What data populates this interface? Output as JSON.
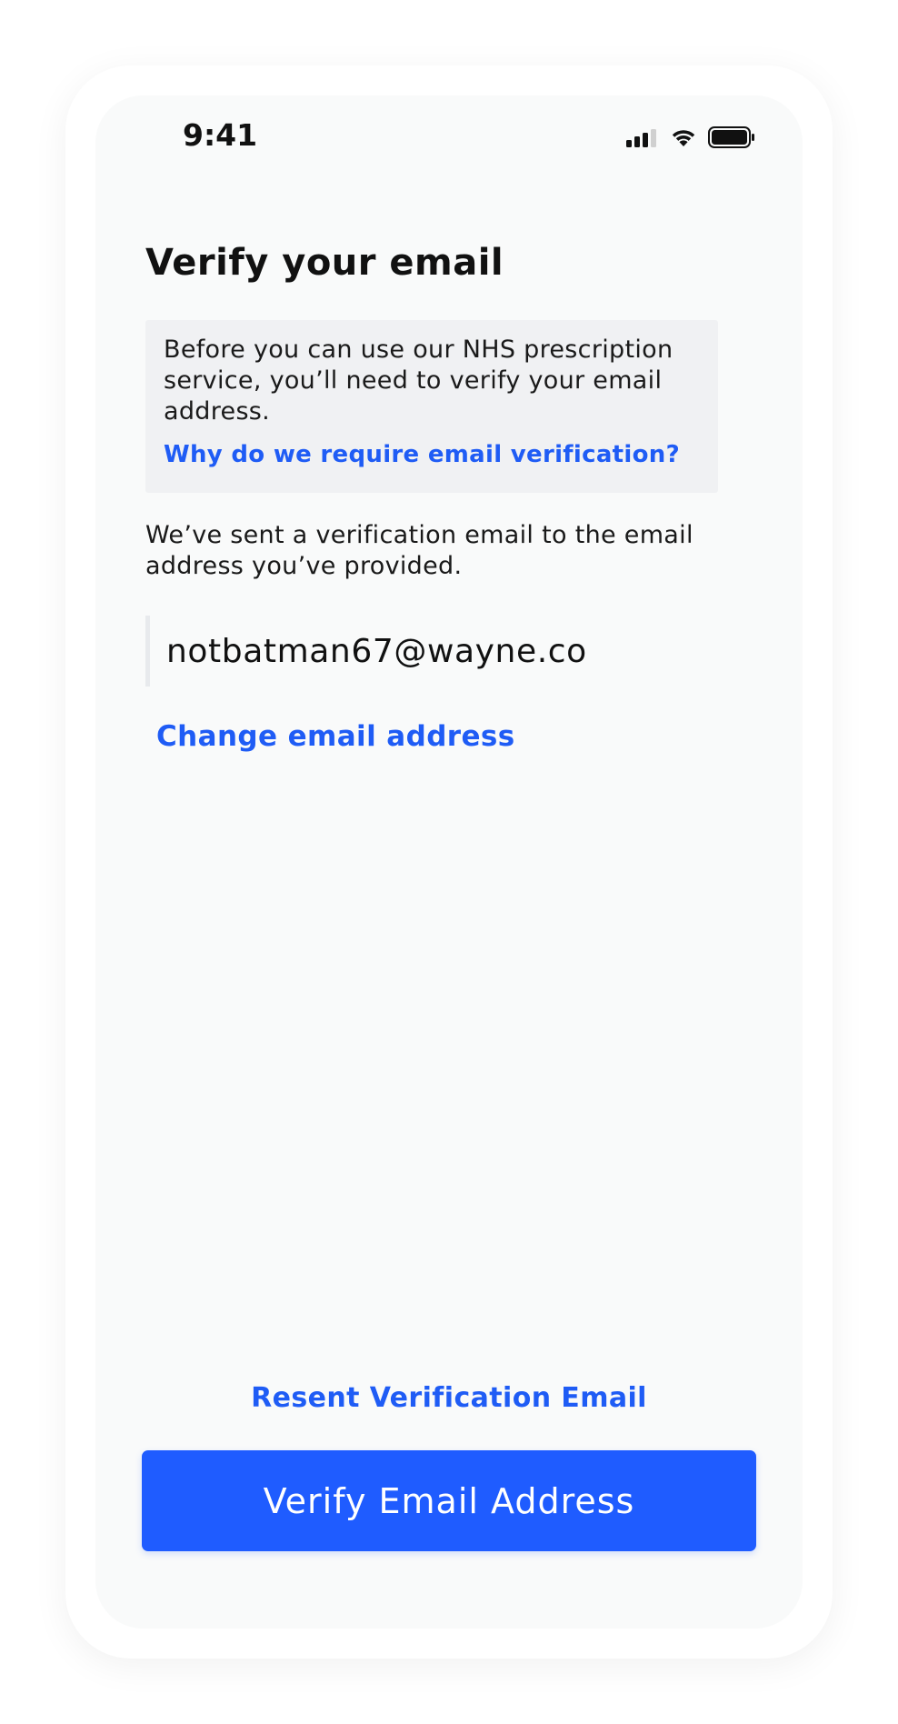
{
  "status_bar": {
    "time": "9:41",
    "icons": [
      "cellular-signal-icon",
      "wifi-icon",
      "battery-icon"
    ]
  },
  "page": {
    "title": "Verify your email"
  },
  "info_box": {
    "text": "Before you can use our NHS prescription service, you’ll need to verify your email address.",
    "link_label": "Why do we require email verification?"
  },
  "sent_message": "We’ve sent a verification email to the email address you’ve provided.",
  "email": {
    "value": "notbatman67@wayne.co"
  },
  "change_email_label": "Change email address",
  "resend_label": "Resent Verification Email",
  "verify_button_label": "Verify Email Address",
  "colors": {
    "accent": "#1f5cff",
    "link": "#1f5cf5",
    "info_box_bg": "#f0f1f3",
    "screen_bg": "#f9fafa",
    "text": "#111111"
  }
}
